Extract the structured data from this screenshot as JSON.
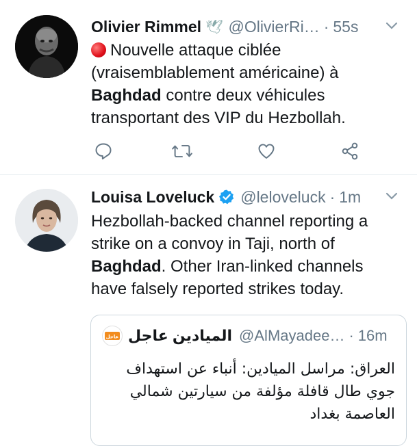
{
  "tweets": [
    {
      "author": "Olivier Rimmel",
      "handle": "@OlivierRi…",
      "time": "55s",
      "text_before": "Nouvelle attaque ciblée (vraisemblablement américaine) à",
      "text_bold": "Baghdad",
      "text_after": "contre deux véhicules transportant des VIP du Hezbollah.",
      "name_emoji": "🕊"
    },
    {
      "author": "Louisa Loveluck",
      "handle": "@leloveluck",
      "time": "1m",
      "text_before": "Hezbollah-backed channel reporting a strike on a convoy in Taji, north of",
      "text_bold": "Baghdad",
      "text_after": ". Other Iran-linked channels have falsely reported strikes today.",
      "quote": {
        "author": "الميادين عاجل",
        "handle": "@AlMayadee…",
        "time": "16m",
        "text": "العراق: مراسل الميادين: أنباء عن استهداف جوي طال قافلة مؤلفة من سيارتين شمالي العاصمة بغداد",
        "logo_text": "عاجل"
      }
    }
  ],
  "separator": "·",
  "colors": {
    "verified": "#1da1f2",
    "action_icon": "#657786",
    "text": "#14171a",
    "muted": "#657786"
  },
  "icons": {
    "reply": "reply-icon",
    "retweet": "retweet-icon",
    "like": "heart-icon",
    "share": "share-icon",
    "caret": "chevron-down-icon"
  }
}
